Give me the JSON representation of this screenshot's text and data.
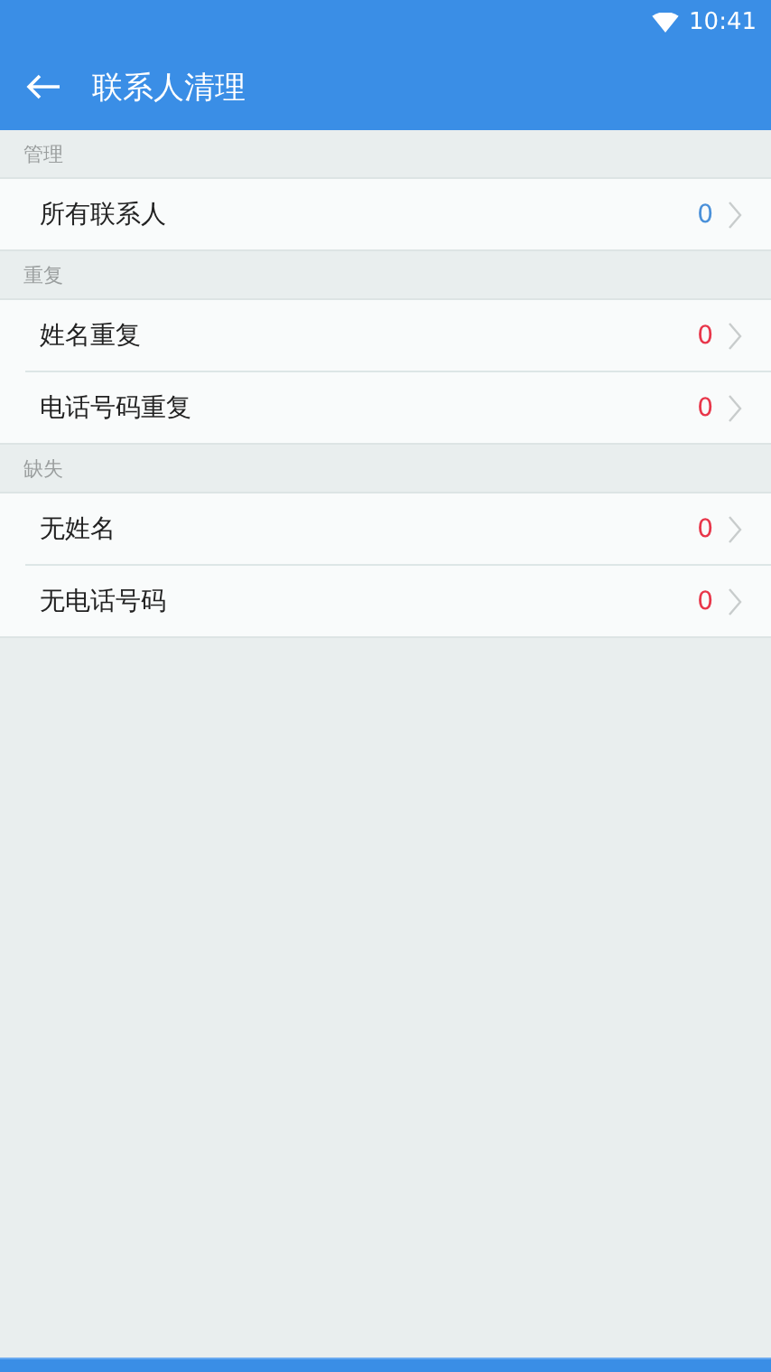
{
  "status_bar": {
    "time": "10:41"
  },
  "app_bar": {
    "title": "联系人清理"
  },
  "sections": [
    {
      "header": "管理",
      "items": [
        {
          "label": "所有联系人",
          "count": "0",
          "color": "#4a90d9"
        }
      ]
    },
    {
      "header": "重复",
      "items": [
        {
          "label": "姓名重复",
          "count": "0",
          "color": "#e8364a"
        },
        {
          "label": "电话号码重复",
          "count": "0",
          "color": "#e8364a"
        }
      ]
    },
    {
      "header": "缺失",
      "items": [
        {
          "label": "无姓名",
          "count": "0",
          "color": "#e8364a"
        },
        {
          "label": "无电话号码",
          "count": "0",
          "color": "#e8364a"
        }
      ]
    }
  ]
}
